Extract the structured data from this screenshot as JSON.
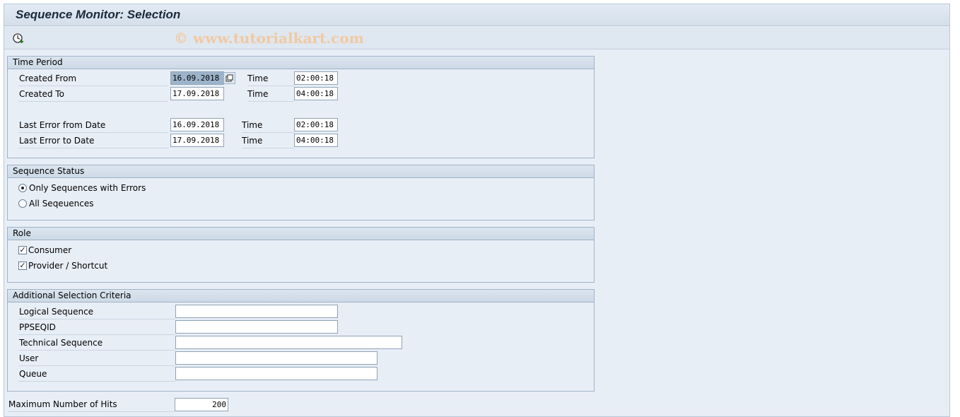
{
  "window": {
    "title": "Sequence Monitor: Selection",
    "watermark": "© www.tutorialkart.com"
  },
  "toolbar": {
    "execute_icon": "execute-clock-icon"
  },
  "time_period": {
    "header": "Time Period",
    "created_from_label": "Created From",
    "created_from_date": "16.09.2018",
    "created_from_time_label": "Time",
    "created_from_time": "02:00:18",
    "created_to_label": "Created To",
    "created_to_date": "17.09.2018",
    "created_to_time_label": "Time",
    "created_to_time": "04:00:18",
    "last_error_from_label": "Last Error from Date",
    "last_error_from_date": "16.09.2018",
    "last_error_from_time_label": "Time",
    "last_error_from_time": "02:00:18",
    "last_error_to_label": "Last Error to Date",
    "last_error_to_date": "17.09.2018",
    "last_error_to_time_label": "Time",
    "last_error_to_time": "04:00:18"
  },
  "sequence_status": {
    "header": "Sequence Status",
    "options": [
      {
        "label": "Only Sequences with Errors",
        "selected": true
      },
      {
        "label": "All Seqeuences",
        "selected": false
      }
    ]
  },
  "role": {
    "header": "Role",
    "options": [
      {
        "label": "Consumer",
        "checked": true
      },
      {
        "label": "Provider / Shortcut",
        "checked": true
      }
    ]
  },
  "additional": {
    "header": "Additional Selection Criteria",
    "logical_sequence_label": "Logical Sequence",
    "logical_sequence_value": "",
    "ppseqid_label": "PPSEQID",
    "ppseqid_value": "",
    "technical_sequence_label": "Technical Sequence",
    "technical_sequence_value": "",
    "user_label": "User",
    "user_value": "",
    "queue_label": "Queue",
    "queue_value": ""
  },
  "max_hits": {
    "label": "Maximum Number of Hits",
    "value": "200"
  }
}
